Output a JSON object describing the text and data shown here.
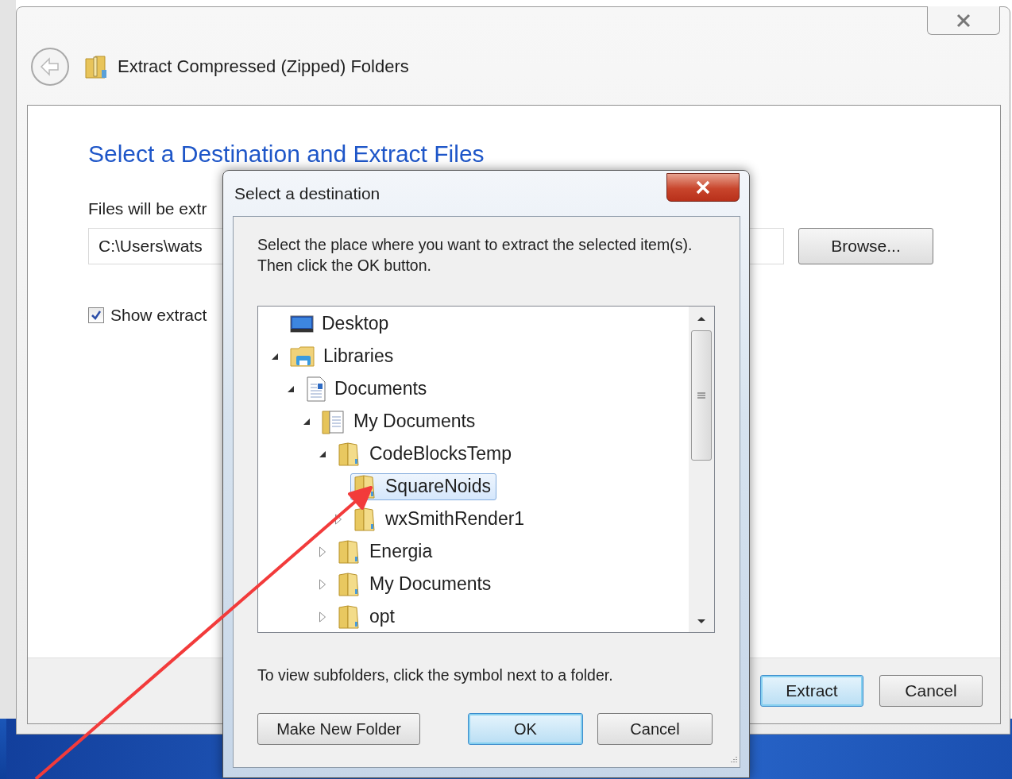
{
  "background_window": {
    "title": "Extract Compressed (Zipped) Folders",
    "heading": "Select a Destination and Extract Files",
    "destination_label": "Files will be extr",
    "destination_path": "C:\\Users\\wats",
    "browse_button": "Browse...",
    "show_files": {
      "label": "Show extract",
      "checked": true
    },
    "buttons": [
      {
        "label": "Extract",
        "default": true
      },
      {
        "label": "Cancel",
        "default": false
      }
    ]
  },
  "dialog": {
    "title": "Select a destination",
    "instructions": "Select the place where you want to extract the selected item(s).  Then click the OK button.",
    "tree": [
      {
        "label": "Desktop",
        "kind": "desktop",
        "selected": false
      },
      {
        "label": "Libraries",
        "kind": "library",
        "expanded": true,
        "selected": false,
        "children": [
          {
            "label": "Documents",
            "kind": "document",
            "expanded": true,
            "selected": false,
            "children": [
              {
                "label": "My Documents",
                "kind": "mydocs",
                "expanded": true,
                "selected": false,
                "children": [
                  {
                    "label": "CodeBlocksTemp",
                    "kind": "folder",
                    "expanded": true,
                    "selected": false,
                    "children": [
                      {
                        "label": "SquareNoids",
                        "kind": "folder",
                        "selected": true
                      },
                      {
                        "label": "wxSmithRender1",
                        "kind": "folder",
                        "expanded": false,
                        "selected": false
                      }
                    ]
                  },
                  {
                    "label": "Energia",
                    "kind": "folder",
                    "expanded": false,
                    "selected": false
                  },
                  {
                    "label": "My Documents",
                    "kind": "folder",
                    "expanded": false,
                    "selected": false
                  },
                  {
                    "label": "opt",
                    "kind": "folder",
                    "expanded": false,
                    "selected": false
                  }
                ]
              }
            ]
          }
        ]
      }
    ],
    "hint": "To view subfolders, click the symbol next to a folder.",
    "buttons": [
      {
        "label": "Make New Folder",
        "default": false
      },
      {
        "label": "OK",
        "default": true
      },
      {
        "label": "Cancel",
        "default": false
      }
    ]
  }
}
